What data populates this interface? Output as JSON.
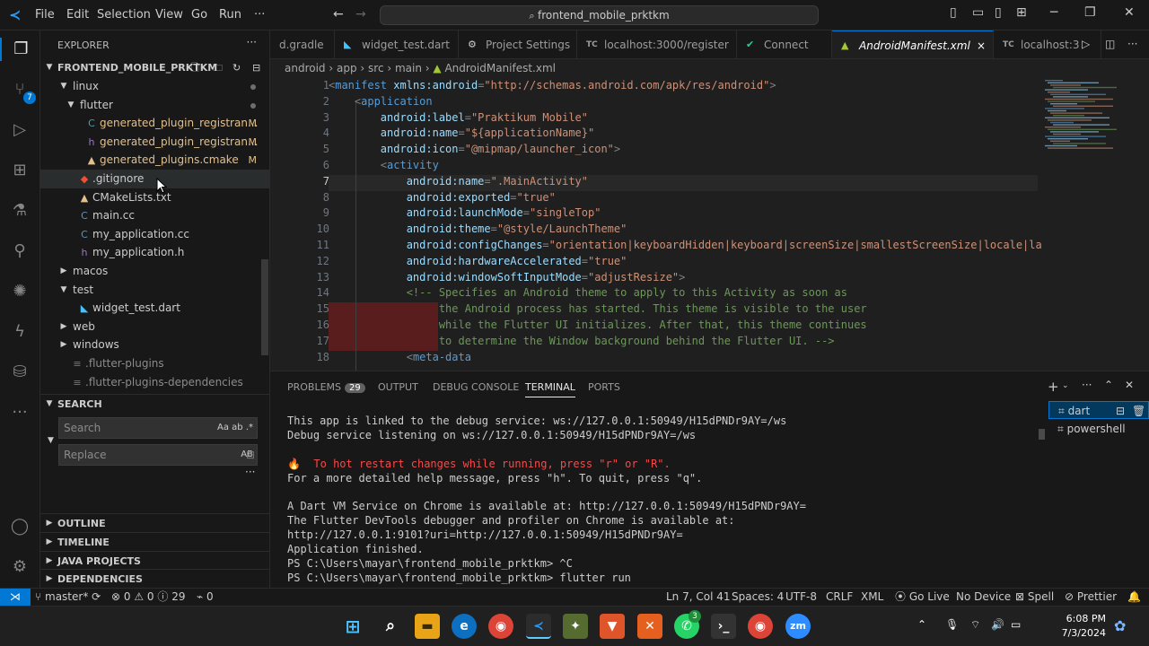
{
  "titlebar": {
    "menu": [
      "File",
      "Edit",
      "Selection",
      "View",
      "Go",
      "Run",
      "···"
    ],
    "command_center": "frontend_mobile_prktkm"
  },
  "explorer": {
    "header": "EXPLORER",
    "project": "FRONTEND_MOBILE_PRKTKM",
    "activity_badge": "7",
    "tree": [
      {
        "label": "linux",
        "type": "folder",
        "open": true,
        "indent": 1,
        "badge": "dot"
      },
      {
        "label": "flutter",
        "type": "folder",
        "open": true,
        "indent": 2,
        "badge": "dot"
      },
      {
        "label": "generated_plugin_registran...",
        "type": "cpp",
        "indent": 3,
        "badge": "M"
      },
      {
        "label": "generated_plugin_registran...",
        "type": "h",
        "indent": 3,
        "badge": "M"
      },
      {
        "label": "generated_plugins.cmake",
        "type": "cmake",
        "indent": 3,
        "badge": "M"
      },
      {
        "label": ".gitignore",
        "type": "git",
        "indent": 2,
        "badge": ""
      },
      {
        "label": "CMakeLists.txt",
        "type": "cmake",
        "indent": 2,
        "badge": ""
      },
      {
        "label": "main.cc",
        "type": "cpp",
        "indent": 2,
        "badge": ""
      },
      {
        "label": "my_application.cc",
        "type": "cpp",
        "indent": 2,
        "badge": ""
      },
      {
        "label": "my_application.h",
        "type": "h",
        "indent": 2,
        "badge": ""
      },
      {
        "label": "macos",
        "type": "folder",
        "open": false,
        "indent": 1,
        "badge": ""
      },
      {
        "label": "test",
        "type": "folder",
        "open": true,
        "indent": 1,
        "badge": ""
      },
      {
        "label": "widget_test.dart",
        "type": "dart",
        "indent": 2,
        "badge": ""
      },
      {
        "label": "web",
        "type": "folder",
        "open": false,
        "indent": 1,
        "badge": ""
      },
      {
        "label": "windows",
        "type": "folder",
        "open": false,
        "indent": 1,
        "badge": ""
      },
      {
        "label": ".flutter-plugins",
        "type": "file",
        "indent": 1,
        "badge": ""
      },
      {
        "label": ".flutter-plugins-dependencies",
        "type": "file",
        "indent": 1,
        "badge": ""
      }
    ],
    "search": {
      "header": "SEARCH",
      "search_placeholder": "Search",
      "replace_placeholder": "Replace",
      "search_opts": "Aa ab .*",
      "replace_opts": "AB"
    },
    "sections": [
      "OUTLINE",
      "TIMELINE",
      "JAVA PROJECTS",
      "DEPENDENCIES"
    ]
  },
  "tabs": [
    {
      "label": "d.gradle",
      "icon": "gradle-icon",
      "active": false
    },
    {
      "label": "widget_test.dart",
      "icon": "dart-icon",
      "active": false
    },
    {
      "label": "Project Settings",
      "icon": "settings-icon",
      "active": false
    },
    {
      "label": "localhost:3000/register",
      "icon": "tc-icon",
      "icon_text": "TC",
      "active": false
    },
    {
      "label": "Connect",
      "icon": "check-icon",
      "active": false
    },
    {
      "label": "AndroidManifest.xml",
      "icon": "android-icon",
      "active": true,
      "close": "×"
    },
    {
      "label": "localhost:3",
      "icon": "tc-icon",
      "icon_text": "TC",
      "active": false
    }
  ],
  "breadcrumb": [
    "android",
    "app",
    "src",
    "main",
    "AndroidManifest.xml"
  ],
  "editor": {
    "current_line": 7,
    "lines": [
      [
        [
          "t-pun",
          "<"
        ],
        [
          "t-tag",
          "manifest "
        ],
        [
          "t-att",
          "xmlns:android"
        ],
        [
          "t-pun",
          "="
        ],
        [
          "t-str",
          "\"http://schemas.android.com/apk/res/android\""
        ],
        [
          "t-pun",
          ">"
        ]
      ],
      [
        [
          "",
          "    "
        ],
        [
          "t-pun",
          "<"
        ],
        [
          "t-tag",
          "application"
        ]
      ],
      [
        [
          "",
          "        "
        ],
        [
          "t-att",
          "android:label"
        ],
        [
          "t-pun",
          "="
        ],
        [
          "t-str",
          "\"Praktikum Mobile\""
        ]
      ],
      [
        [
          "",
          "        "
        ],
        [
          "t-att",
          "android:name"
        ],
        [
          "t-pun",
          "="
        ],
        [
          "t-str",
          "\"${applicationName}\""
        ]
      ],
      [
        [
          "",
          "        "
        ],
        [
          "t-att",
          "android:icon"
        ],
        [
          "t-pun",
          "="
        ],
        [
          "t-str",
          "\"@mipmap/launcher_icon\""
        ],
        [
          "t-pun",
          ">"
        ]
      ],
      [
        [
          "",
          "        "
        ],
        [
          "t-pun",
          "<"
        ],
        [
          "t-tag",
          "activity"
        ]
      ],
      [
        [
          "",
          "            "
        ],
        [
          "t-att",
          "android:name"
        ],
        [
          "t-pun",
          "="
        ],
        [
          "t-str",
          "\".MainActivity\""
        ]
      ],
      [
        [
          "",
          "            "
        ],
        [
          "t-att",
          "android:exported"
        ],
        [
          "t-pun",
          "="
        ],
        [
          "t-str",
          "\"true\""
        ]
      ],
      [
        [
          "",
          "            "
        ],
        [
          "t-att",
          "android:launchMode"
        ],
        [
          "t-pun",
          "="
        ],
        [
          "t-str",
          "\"singleTop\""
        ]
      ],
      [
        [
          "",
          "            "
        ],
        [
          "t-att",
          "android:theme"
        ],
        [
          "t-pun",
          "="
        ],
        [
          "t-str",
          "\"@style/LaunchTheme\""
        ]
      ],
      [
        [
          "",
          "            "
        ],
        [
          "t-att",
          "android:configChanges"
        ],
        [
          "t-pun",
          "="
        ],
        [
          "t-str",
          "\"orientation|keyboardHidden|keyboard|screenSize|smallestScreenSize|locale|la"
        ]
      ],
      [
        [
          "",
          "            "
        ],
        [
          "t-att",
          "android:hardwareAccelerated"
        ],
        [
          "t-pun",
          "="
        ],
        [
          "t-str",
          "\"true\""
        ]
      ],
      [
        [
          "",
          "            "
        ],
        [
          "t-att",
          "android:windowSoftInputMode"
        ],
        [
          "t-pun",
          "="
        ],
        [
          "t-str",
          "\"adjustResize\""
        ],
        [
          "t-pun",
          ">"
        ]
      ],
      [
        [
          "",
          "            "
        ],
        [
          "t-com",
          "<!-- Specifies an Android theme to apply to this Activity as soon as"
        ]
      ],
      [
        [
          "",
          "                 "
        ],
        [
          "t-com",
          "the Android process has started. This theme is visible to the user"
        ]
      ],
      [
        [
          "",
          "                 "
        ],
        [
          "t-com",
          "while the Flutter UI initializes. After that, this theme continues"
        ]
      ],
      [
        [
          "",
          "                 "
        ],
        [
          "t-com",
          "to determine the Window background behind the Flutter UI. -->"
        ]
      ],
      [
        [
          "",
          "            "
        ],
        [
          "t-pun",
          "<"
        ],
        [
          "t-tag",
          "meta-data"
        ]
      ]
    ]
  },
  "panel": {
    "tabs": [
      "PROBLEMS",
      "OUTPUT",
      "DEBUG CONSOLE",
      "TERMINAL",
      "PORTS"
    ],
    "problems_count": "29",
    "active_tab": "TERMINAL",
    "terminal_lines": [
      {
        "text": "This app is linked to the debug service: ws://127.0.0.1:50949/H15dPNDr9AY=/ws",
        "cls": ""
      },
      {
        "text": "Debug service listening on ws://127.0.0.1:50949/H15dPNDr9AY=/ws",
        "cls": ""
      },
      {
        "text": "",
        "cls": ""
      },
      {
        "text": "🔥  To hot restart changes while running, press \"r\" or \"R\".",
        "cls": "term-warn"
      },
      {
        "text": "For a more detailed help message, press \"h\". To quit, press \"q\".",
        "cls": ""
      },
      {
        "text": "",
        "cls": ""
      },
      {
        "text": "A Dart VM Service on Chrome is available at: http://127.0.0.1:50949/H15dPNDr9AY=",
        "cls": ""
      },
      {
        "text": "The Flutter DevTools debugger and profiler on Chrome is available at:",
        "cls": ""
      },
      {
        "text": "http://127.0.0.1:9101?uri=http://127.0.0.1:50949/H15dPNDr9AY=",
        "cls": ""
      },
      {
        "text": "Application finished.",
        "cls": ""
      },
      {
        "text": "PS C:\\Users\\mayar\\frontend_mobile_prktkm> ^C",
        "cls": ""
      },
      {
        "text": "PS C:\\Users\\mayar\\frontend_mobile_prktkm> flutter run",
        "cls": ""
      }
    ],
    "terminals": [
      "dart",
      "powershell"
    ]
  },
  "statusbar": {
    "remote": "⋊",
    "branch": "master*",
    "errors": "0",
    "warnings": "0",
    "info": "29",
    "ports": "0",
    "position": "Ln 7, Col 41",
    "spaces": "Spaces: 4",
    "encoding": "UTF-8",
    "eol": "CRLF",
    "language": "XML",
    "golive": "Go Live",
    "device": "No Device",
    "spell": "Spell",
    "prettier": "Prettier"
  },
  "taskbar": {
    "time": "6:08 PM",
    "date": "7/3/2024",
    "whatsapp_badge": "3"
  },
  "colors": {
    "accent": "#0078d4",
    "modified": "#e2c08d",
    "diff_removed_bg": "#5a1d1d",
    "current_line_bg": "#282828"
  }
}
